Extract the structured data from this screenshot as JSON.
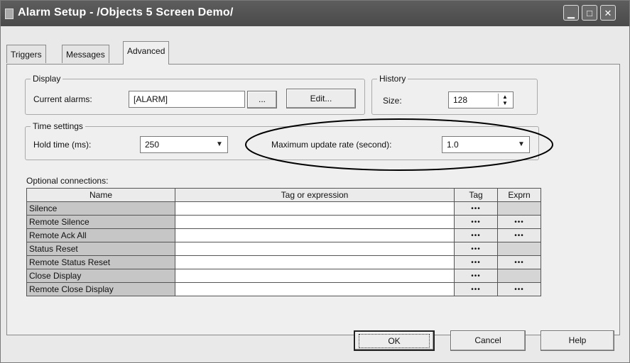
{
  "window": {
    "title": "Alarm Setup - /Objects 5 Screen Demo/"
  },
  "tabs": [
    {
      "label": "Triggers",
      "active": false
    },
    {
      "label": "Messages",
      "active": false
    },
    {
      "label": "Advanced",
      "active": true
    }
  ],
  "display": {
    "legend": "Display",
    "current_alarms_label": "Current alarms:",
    "current_alarms_value": "[ALARM]",
    "browse_label": "...",
    "edit_label": "Edit..."
  },
  "history": {
    "legend": "History",
    "size_label": "Size:",
    "size_value": "128"
  },
  "time_settings": {
    "legend": "Time settings",
    "hold_time_label": "Hold time (ms):",
    "hold_time_value": "250",
    "max_update_label": "Maximum update rate (second):",
    "max_update_value": "1.0"
  },
  "connections": {
    "label": "Optional connections:",
    "headers": [
      "Name",
      "Tag or expression",
      "Tag",
      "Exprn"
    ],
    "rows": [
      {
        "name": "Silence",
        "tag": "•••",
        "exprn": ""
      },
      {
        "name": "Remote Silence",
        "tag": "•••",
        "exprn": "•••"
      },
      {
        "name": "Remote Ack All",
        "tag": "•••",
        "exprn": "•••"
      },
      {
        "name": "Status Reset",
        "tag": "•••",
        "exprn": ""
      },
      {
        "name": "Remote Status Reset",
        "tag": "•••",
        "exprn": "•••"
      },
      {
        "name": "Close Display",
        "tag": "•••",
        "exprn": ""
      },
      {
        "name": "Remote Close Display",
        "tag": "•••",
        "exprn": "•••"
      }
    ]
  },
  "footer": {
    "ok_label": "OK",
    "cancel_label": "Cancel",
    "help_label": "Help"
  }
}
